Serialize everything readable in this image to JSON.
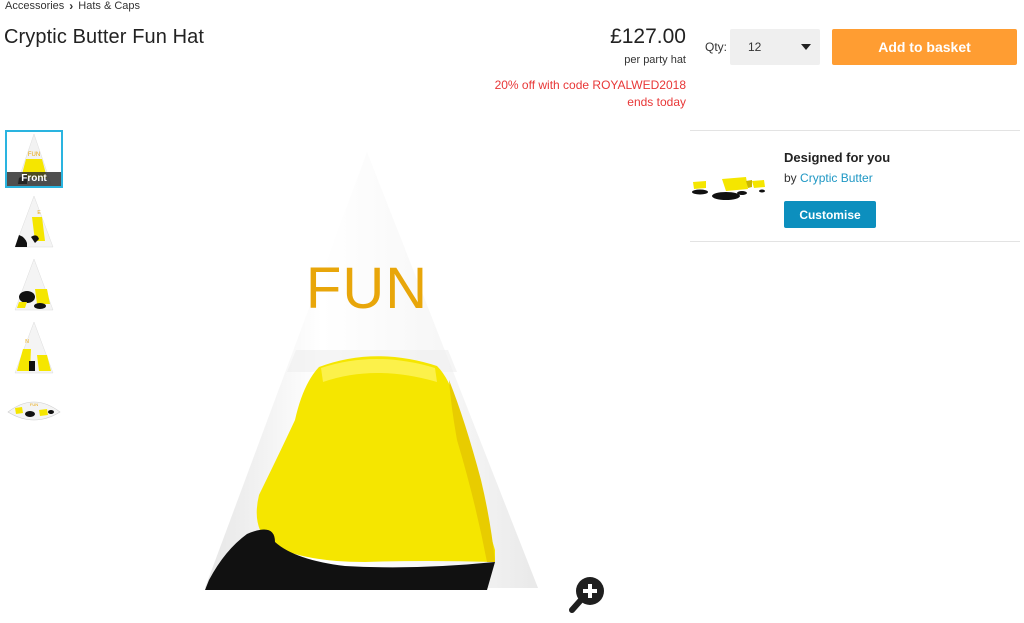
{
  "breadcrumb": {
    "items": [
      "Accessories",
      "Hats & Caps"
    ]
  },
  "product": {
    "title": "Cryptic Butter Fun Hat",
    "price": "£127.00",
    "price_unit": "per party hat",
    "promo_line1": "20% off with code ROYALWED2018",
    "promo_line2": "ends today",
    "hat_text": "FUN"
  },
  "purchase": {
    "qty_label": "Qty:",
    "qty_value": "12",
    "add_to_basket_label": "Add to basket"
  },
  "gallery": {
    "thumbnails": [
      {
        "view": "Front",
        "label": "Front",
        "selected": true
      },
      {
        "view": "side-1",
        "label": "",
        "selected": false
      },
      {
        "view": "side-2",
        "label": "",
        "selected": false
      },
      {
        "view": "side-3",
        "label": "",
        "selected": false
      },
      {
        "view": "flat",
        "label": "",
        "selected": false
      }
    ],
    "zoom_icon": "zoom-in-icon"
  },
  "designer": {
    "title": "Designed for you",
    "by_prefix": "by",
    "designer_name": "Cryptic Butter",
    "customise_label": "Customise"
  },
  "colors": {
    "accent_orange": "#ff9d32",
    "link_blue": "#1e97c4",
    "customise_blue": "#0c8fbe",
    "promo_red": "#e83737",
    "thumb_selected": "#2ab4e0",
    "hat_yellow": "#f5e600",
    "hat_text_gold": "#e8a60a"
  }
}
